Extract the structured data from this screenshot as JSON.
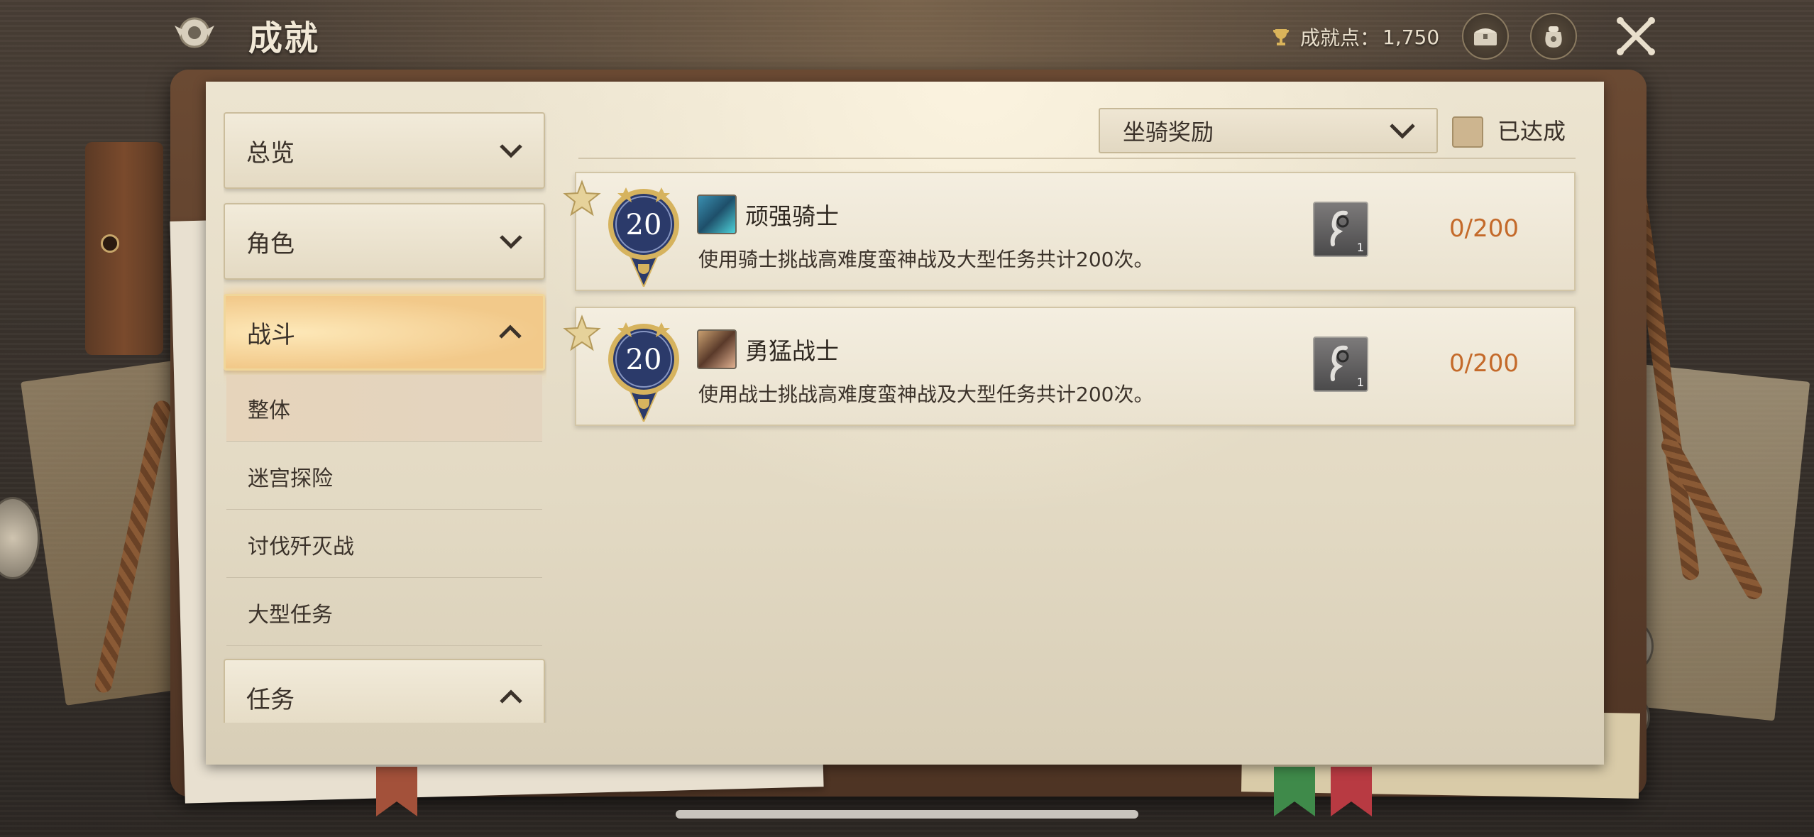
{
  "header": {
    "title": "成就",
    "points_label": "成就点：",
    "points_value": "1,750"
  },
  "sidebar": {
    "categories": [
      {
        "label": "总览",
        "expanded": false
      },
      {
        "label": "角色",
        "expanded": false
      },
      {
        "label": "战斗",
        "expanded": true
      },
      {
        "label": "任务",
        "expanded": true
      }
    ],
    "battle_subitems": [
      {
        "label": "整体",
        "selected": true
      },
      {
        "label": "迷宫探险",
        "selected": false
      },
      {
        "label": "讨伐歼灭战",
        "selected": false
      },
      {
        "label": "大型任务",
        "selected": false
      }
    ]
  },
  "filter": {
    "selected": "坐骑奖励",
    "completed_label": "已达成",
    "completed_checked": false
  },
  "achievements": [
    {
      "level": "20",
      "title": "顽强骑士",
      "description": "使用骑士挑战高难度蛮神战及大型任务共计200次。",
      "reward_qty": "1",
      "progress": "0/200",
      "class_icon": "knight-icon"
    },
    {
      "level": "20",
      "title": "勇猛战士",
      "description": "使用战士挑战高难度蛮神战及大型任务共计200次。",
      "reward_qty": "1",
      "progress": "0/200",
      "class_icon": "warrior-icon"
    }
  ],
  "colors": {
    "progress": "#c46a2a",
    "active_category": "#f2c98a",
    "badge_blue": "#2b3a6a",
    "badge_gold": "#d6b35e"
  }
}
